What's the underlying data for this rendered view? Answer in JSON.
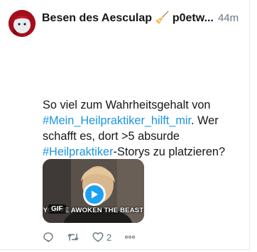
{
  "tweet": {
    "author": "Besen des Aesculap 🧹 p0etw...",
    "time": "44m",
    "text_parts": [
      "So viel zum Wahrheitsgehalt von ",
      "#Mein_Heilpraktiker_hilft_mir",
      ". Wer schafft es, dort >5 absurde ",
      "#Heilpraktiker",
      "-Storys zu platzieren?"
    ],
    "media": {
      "badge": "GIF",
      "caption": "YOU'VE AWOKEN THE BEAST",
      "play_icon": "play-icon"
    },
    "actions": {
      "reply_icon": "reply-icon",
      "retweet_icon": "retweet-icon",
      "like_icon": "heart-icon",
      "like_count": "2",
      "more_icon": "more-icon"
    }
  },
  "colors": {
    "link": "#1b95e0",
    "play_button": "#1da1f2",
    "secondary_text": "#657786"
  }
}
